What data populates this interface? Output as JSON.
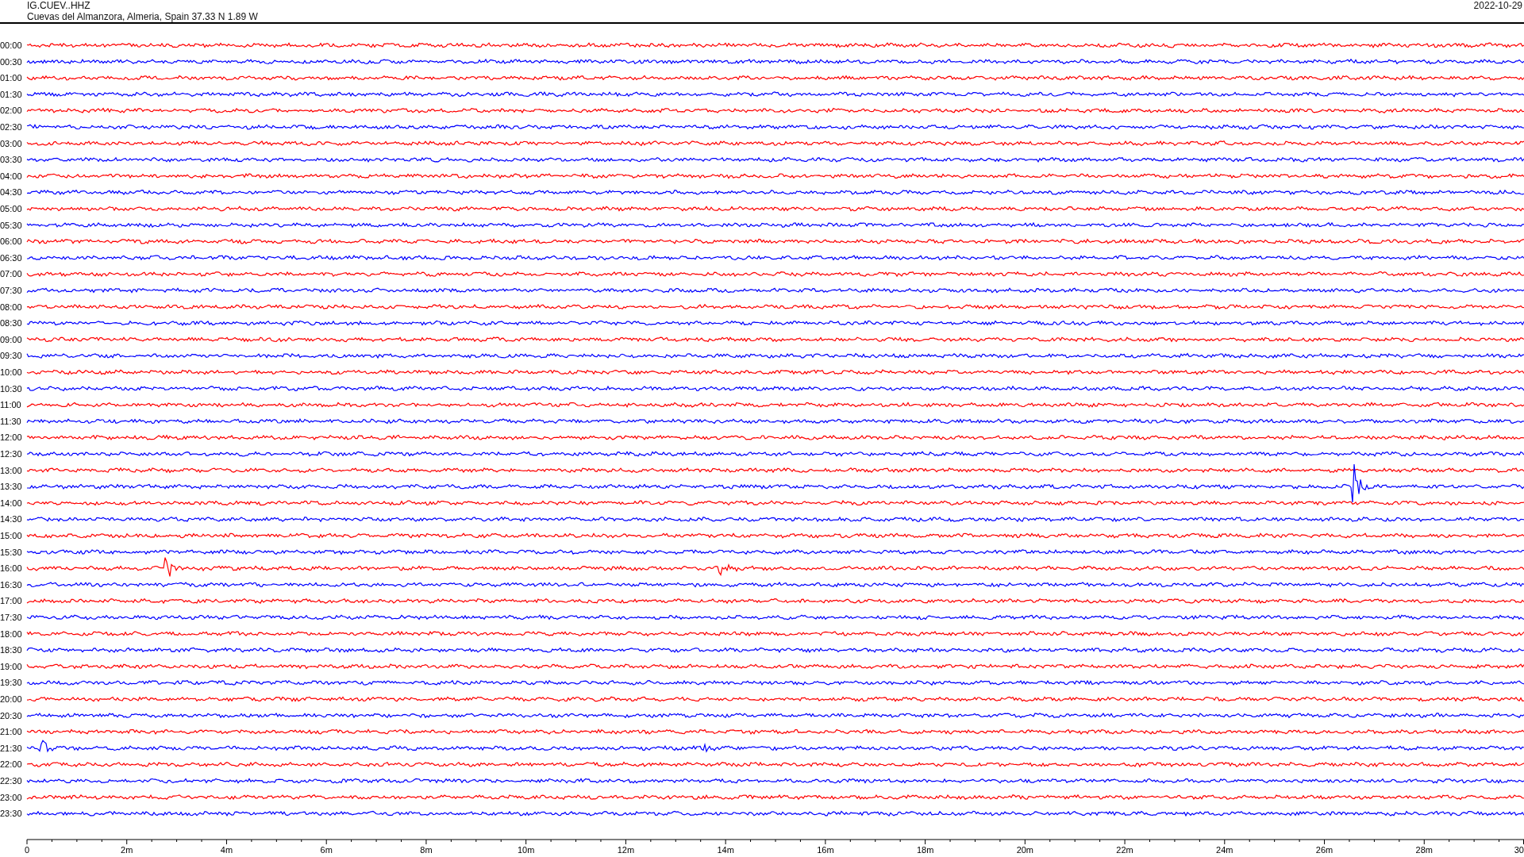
{
  "header": {
    "station": "IG.CUEV..HHZ",
    "location": "Cuevas del Almanzora, Almeria, Spain  37.33 N 1.89 W",
    "date": "2022-10-29"
  },
  "rows": [
    {
      "label": "00:00",
      "color": "#ff0000"
    },
    {
      "label": "00:30",
      "color": "#0000ff"
    },
    {
      "label": "01:00",
      "color": "#ff0000"
    },
    {
      "label": "01:30",
      "color": "#0000ff"
    },
    {
      "label": "02:00",
      "color": "#ff0000"
    },
    {
      "label": "02:30",
      "color": "#0000ff"
    },
    {
      "label": "03:00",
      "color": "#ff0000"
    },
    {
      "label": "03:30",
      "color": "#0000ff"
    },
    {
      "label": "04:00",
      "color": "#ff0000"
    },
    {
      "label": "04:30",
      "color": "#0000ff"
    },
    {
      "label": "05:00",
      "color": "#ff0000"
    },
    {
      "label": "05:30",
      "color": "#0000ff"
    },
    {
      "label": "06:00",
      "color": "#ff0000"
    },
    {
      "label": "06:30",
      "color": "#0000ff"
    },
    {
      "label": "07:00",
      "color": "#ff0000"
    },
    {
      "label": "07:30",
      "color": "#0000ff"
    },
    {
      "label": "08:00",
      "color": "#ff0000"
    },
    {
      "label": "08:30",
      "color": "#0000ff"
    },
    {
      "label": "09:00",
      "color": "#ff0000"
    },
    {
      "label": "09:30",
      "color": "#0000ff"
    },
    {
      "label": "10:00",
      "color": "#ff0000"
    },
    {
      "label": "10:30",
      "color": "#0000ff"
    },
    {
      "label": "11:00",
      "color": "#ff0000"
    },
    {
      "label": "11:30",
      "color": "#0000ff"
    },
    {
      "label": "12:00",
      "color": "#ff0000"
    },
    {
      "label": "12:30",
      "color": "#0000ff"
    },
    {
      "label": "13:00",
      "color": "#ff0000"
    },
    {
      "label": "13:30",
      "color": "#0000ff"
    },
    {
      "label": "14:00",
      "color": "#ff0000"
    },
    {
      "label": "14:30",
      "color": "#0000ff"
    },
    {
      "label": "15:00",
      "color": "#ff0000"
    },
    {
      "label": "15:30",
      "color": "#0000ff"
    },
    {
      "label": "16:00",
      "color": "#ff0000"
    },
    {
      "label": "16:30",
      "color": "#0000ff"
    },
    {
      "label": "17:00",
      "color": "#ff0000"
    },
    {
      "label": "17:30",
      "color": "#0000ff"
    },
    {
      "label": "18:00",
      "color": "#ff0000"
    },
    {
      "label": "18:30",
      "color": "#0000ff"
    },
    {
      "label": "19:00",
      "color": "#ff0000"
    },
    {
      "label": "19:30",
      "color": "#0000ff"
    },
    {
      "label": "20:00",
      "color": "#ff0000"
    },
    {
      "label": "20:30",
      "color": "#0000ff"
    },
    {
      "label": "21:00",
      "color": "#ff0000"
    },
    {
      "label": "21:30",
      "color": "#0000ff"
    },
    {
      "label": "22:00",
      "color": "#ff0000"
    },
    {
      "label": "22:30",
      "color": "#0000ff"
    },
    {
      "label": "23:00",
      "color": "#ff0000"
    },
    {
      "label": "23:30",
      "color": "#0000ff"
    }
  ],
  "axis": {
    "tick_labels": [
      "0",
      "2m",
      "4m",
      "6m",
      "8m",
      "10m",
      "12m",
      "14m",
      "16m",
      "18m",
      "20m",
      "22m",
      "24m",
      "26m",
      "28m",
      "30"
    ]
  }
}
